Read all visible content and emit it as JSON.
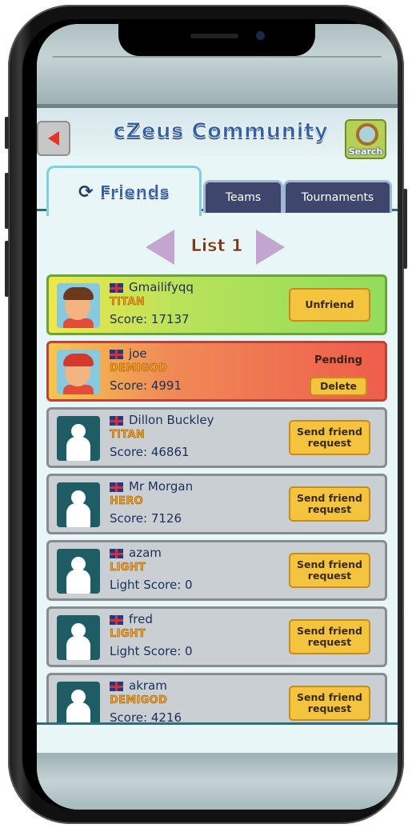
{
  "header": {
    "title": "cZeus Community",
    "search_label": "Search"
  },
  "tabs": [
    {
      "label": "Friends",
      "active": true
    },
    {
      "label": "Teams",
      "active": false
    },
    {
      "label": "Tournaments",
      "active": false
    }
  ],
  "list_title": "List 1",
  "friends": [
    {
      "name": "Gmailifyqq",
      "rank": "TITAN",
      "score": "Score: 17137",
      "status": "friend",
      "action": "Unfriend"
    },
    {
      "name": "joe",
      "rank": "DEMIGOD",
      "score": "Score: 4991",
      "status": "pending",
      "pending_label": "Pending",
      "action": "Delete"
    },
    {
      "name": "Dillon Buckley",
      "rank": "TITAN",
      "score": "Score: 46861",
      "status": "none",
      "action": "Send friend request"
    },
    {
      "name": "Mr Morgan",
      "rank": "HERO",
      "score": "Score: 7126",
      "status": "none",
      "action": "Send friend request"
    },
    {
      "name": "azam",
      "rank": "LIGHT",
      "score": "Light Score: 0",
      "status": "none",
      "action": "Send friend request"
    },
    {
      "name": "fred",
      "rank": "LIGHT",
      "score": "Light Score: 0",
      "status": "none",
      "action": "Send friend request"
    },
    {
      "name": "akram",
      "rank": "DEMIGOD",
      "score": "Score: 4216",
      "status": "none",
      "action": "Send friend request"
    }
  ],
  "colors": {
    "title": "#3060a8",
    "rank": "#f6a21a",
    "button": "#f5c43f",
    "friend_row": "#92dc5b",
    "pending_row": "#ee5d4b",
    "other_row": "#c9cfd3"
  }
}
